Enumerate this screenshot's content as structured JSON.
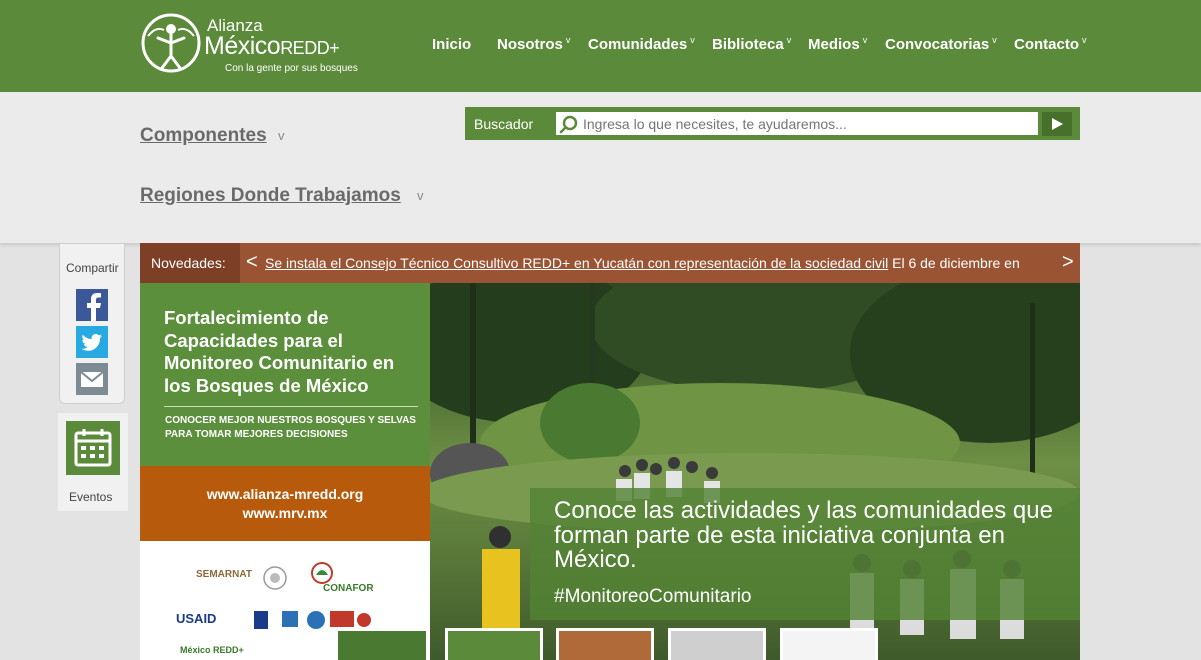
{
  "header": {
    "logo": {
      "line1": "Alianza",
      "line2": "México",
      "line2b": "REDD+",
      "tagline": "Con la gente por sus bosques"
    },
    "nav": [
      {
        "label": "Inicio",
        "has_caret": false
      },
      {
        "label": "Nosotros",
        "has_caret": true
      },
      {
        "label": "Comunidades",
        "has_caret": true
      },
      {
        "label": "Biblioteca",
        "has_caret": true
      },
      {
        "label": "Medios",
        "has_caret": true
      },
      {
        "label": "Convocatorias",
        "has_caret": true
      },
      {
        "label": "Contacto",
        "has_caret": true
      }
    ],
    "caret": "v"
  },
  "menu": {
    "componentes": "Componentes",
    "regiones": "Regiones Donde Trabajamos",
    "caret": "v"
  },
  "search": {
    "label": "Buscador",
    "placeholder": "Ingresa lo que necesites, te ayudaremos...",
    "button_glyph": "▶"
  },
  "share": {
    "label": "Compartir",
    "events_label": "Eventos"
  },
  "ticker": {
    "label": "Novedades:",
    "prev": "<",
    "next": ">",
    "link_text": "Se instala el Consejo Técnico Consultivo REDD+ en Yucatán con representación de la sociedad civil",
    "trailing_text": " El 6 de diciembre en"
  },
  "hero": {
    "panel_title": "Fortalecimiento de Capacidades para el Monitoreo Comunitario en los Bosques de México",
    "panel_subtitle": "CONOCER MEJOR NUESTROS BOSQUES Y SELVAS PARA TOMAR MEJORES DECISIONES",
    "url1": "www.alianza-mredd.org",
    "url2": "www.mrv.mx",
    "logos": {
      "semarnat": "SEMARNAT",
      "conafor": "CONAFOR",
      "usaid": "USAID",
      "mexico_redd": "México REDD+"
    },
    "caption": "Conoce las actividades y las comunidades que forman parte de esta iniciativa conjunta en México.",
    "hashtag": "#MonitoreoComunitario"
  }
}
